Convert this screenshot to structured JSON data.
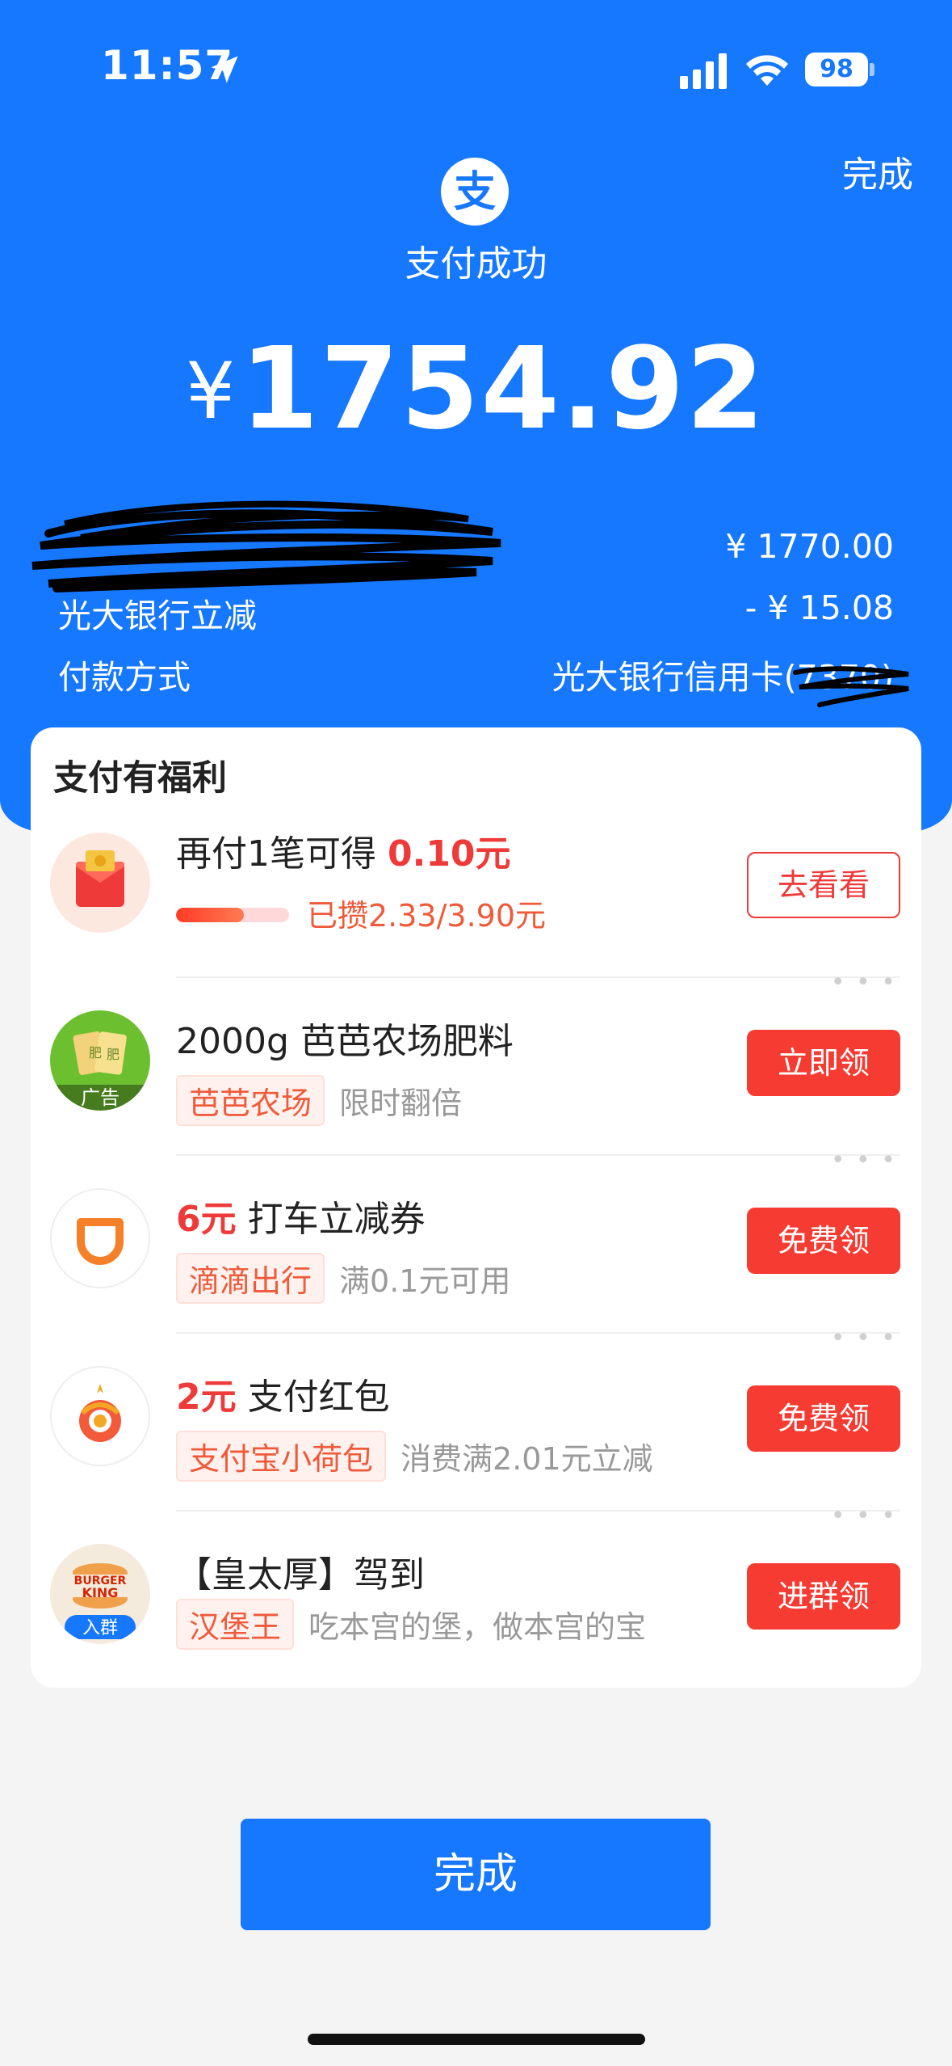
{
  "status_bar": {
    "time": "11:57",
    "battery": "98"
  },
  "header": {
    "done_label": "完成",
    "title": "支付成功",
    "currency_symbol": "¥",
    "amount": "1754.92"
  },
  "details": [
    {
      "label": "",
      "value": "¥ 1770.00"
    },
    {
      "label": "光大银行立减",
      "value": "- ¥ 15.08"
    },
    {
      "label": "付款方式",
      "value": "光大银行信用卡(7370)"
    }
  ],
  "benefits": {
    "title": "支付有福利",
    "items": [
      {
        "prefix": "再付1笔可得 ",
        "highlight": "0.10元",
        "progress_text": "已攒2.33/3.90元",
        "progress_fraction": 0.6,
        "button": "去看看",
        "icon": "red-envelope-icon"
      },
      {
        "title": "2000g 芭芭农场肥料",
        "tag": "芭芭农场",
        "subtitle": "限时翻倍",
        "avatar_badge": "广告",
        "button": "立即领",
        "icon": "fertilizer-icon"
      },
      {
        "highlight": "6元",
        "title": " 打车立减券",
        "tag": "滴滴出行",
        "subtitle": "满0.1元可用",
        "button": "免费领",
        "icon": "didi-logo-icon"
      },
      {
        "highlight": "2元",
        "title": " 支付红包",
        "tag": "支付宝小荷包",
        "subtitle": "消费满2.01元立减",
        "button": "免费领",
        "icon": "pocket-logo-icon"
      },
      {
        "title": "【皇太厚】驾到",
        "tag": "汉堡王",
        "subtitle": "吃本宫的堡，做本宫的宝",
        "avatar_badge": "入群",
        "logo_text": "BURGER KING",
        "button": "进群领",
        "icon": "burger-king-logo-icon"
      }
    ]
  },
  "footer": {
    "done_button": "完成"
  },
  "colors": {
    "brand_blue": "#1677ff",
    "accent_red": "#f53b32"
  }
}
